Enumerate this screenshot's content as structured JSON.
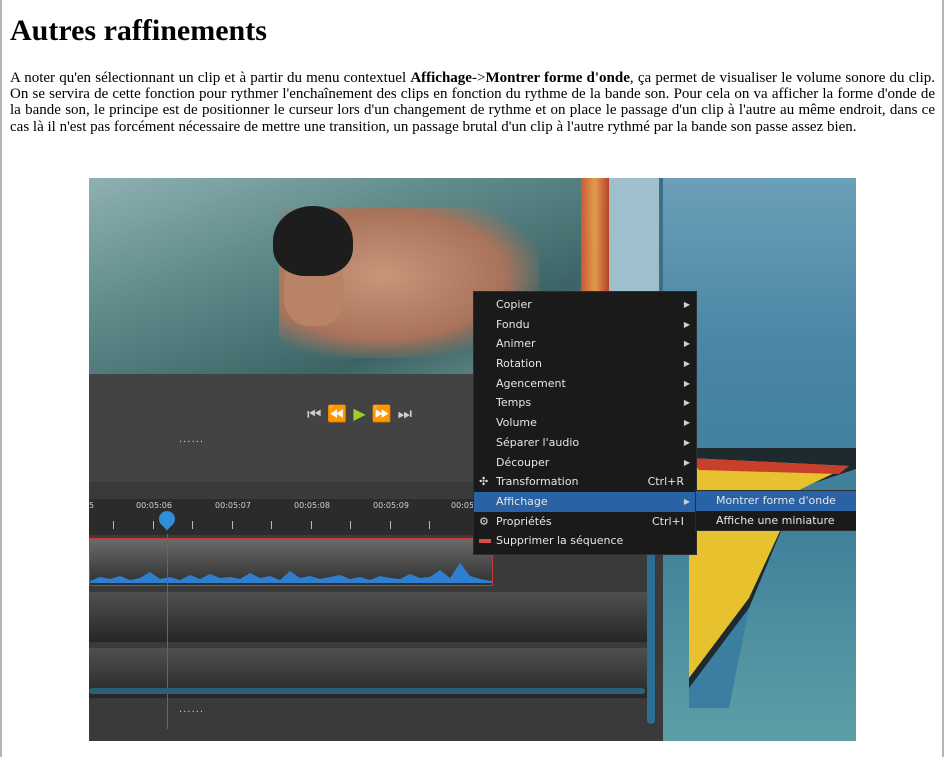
{
  "heading": "Autres raffinements",
  "paragraph": {
    "before": "A noter qu'en sélectionnant un clip et à partir du menu contextuel ",
    "strong1": "Affichage",
    "sep": "->",
    "strong2": "Montrer forme d'onde",
    "after": ", ça permet de visualiser le volume sonore du clip. On se servira de cette fonction pour rythmer l'enchaînement des clips en fonction du rythme de la bande son. Pour cela on va afficher la forme d'onde de la bande son, le principe est de positionner le curseur lors d'un changement de rythme et on place le passage d'un clip à l'autre au même endroit, dans ce cas là il n'est pas forcément nécessaire de mettre une transition, un passage brutal d'un clip à l'autre rythmé par la bande son passe assez bien."
  },
  "screenshot": {
    "player_controls": [
      "⏮",
      "⏪",
      "▶",
      "⏩",
      "⏭"
    ],
    "timeline_dots": "......",
    "ruler_labels": [
      "5",
      "00:05:06",
      "00:05:07",
      "00:05:08",
      "00:05:09",
      "00:05"
    ],
    "context_menu": {
      "items": [
        {
          "label": "Copier",
          "has_submenu": true
        },
        {
          "label": "Fondu",
          "has_submenu": true
        },
        {
          "label": "Animer",
          "has_submenu": true
        },
        {
          "label": "Rotation",
          "has_submenu": true
        },
        {
          "label": "Agencement",
          "has_submenu": true
        },
        {
          "label": "Temps",
          "has_submenu": true
        },
        {
          "label": "Volume",
          "has_submenu": true
        },
        {
          "label": "Séparer l'audio",
          "has_submenu": true
        },
        {
          "label": "Découper",
          "has_submenu": true
        },
        {
          "label": "Transformation",
          "shortcut": "Ctrl+R",
          "icon": "move-icon"
        },
        {
          "label": "Affichage",
          "has_submenu": true,
          "active": true
        },
        {
          "label": "Propriétés",
          "shortcut": "Ctrl+I",
          "icon": "gear-icon"
        },
        {
          "label": "Supprimer la séquence",
          "icon": "delete-bar-icon"
        }
      ],
      "submenu": [
        {
          "label": "Montrer forme d'onde",
          "active": true
        },
        {
          "label": "Affiche une miniature"
        }
      ]
    },
    "colors": {
      "menu_bg": "#1a1a1a",
      "menu_highlight": "#2a62a6",
      "playhead": "#d33333",
      "waveform": "#2e7fd0"
    }
  }
}
